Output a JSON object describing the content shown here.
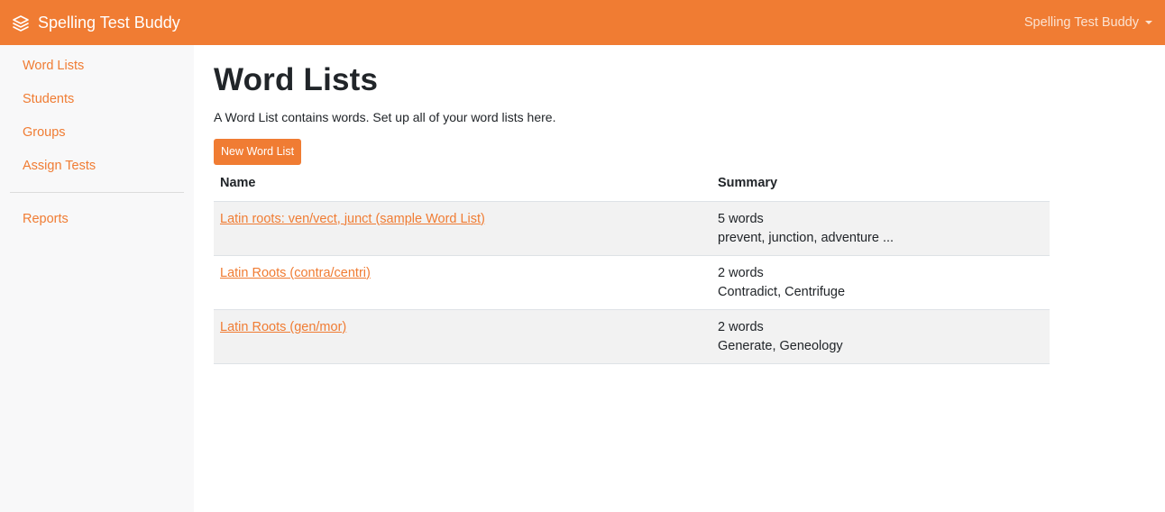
{
  "app": {
    "brand_name": "Spelling Test Buddy",
    "user_menu_label": "Spelling Test Buddy",
    "accent_color": "#f07c33"
  },
  "sidebar": {
    "items": [
      {
        "label": "Word Lists"
      },
      {
        "label": "Students"
      },
      {
        "label": "Groups"
      },
      {
        "label": "Assign Tests"
      }
    ],
    "secondary_items": [
      {
        "label": "Reports"
      }
    ]
  },
  "main": {
    "title": "Word Lists",
    "description": "A Word List contains words. Set up all of your word lists here.",
    "new_button_label": "New Word List",
    "table": {
      "headers": {
        "name": "Name",
        "summary": "Summary"
      },
      "rows": [
        {
          "name": "Latin roots: ven/vect, junct (sample Word List)",
          "count": "5 words",
          "words": "prevent, junction, adventure ..."
        },
        {
          "name": "Latin Roots (contra/centri)",
          "count": "2 words",
          "words": "Contradict, Centrifuge"
        },
        {
          "name": "Latin Roots (gen/mor)",
          "count": "2 words",
          "words": "Generate, Geneology"
        }
      ]
    }
  }
}
